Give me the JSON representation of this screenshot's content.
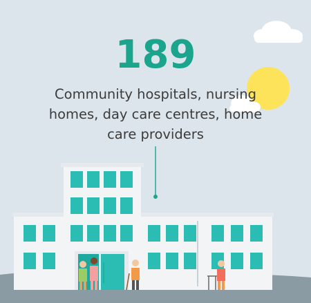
{
  "stat": {
    "number": "189",
    "caption": "Community hospitals, nursing homes, day care centres, home care providers"
  },
  "colors": {
    "background": "#dce5ec",
    "accent_number": "#1aa58c",
    "window_teal": "#2bbcb3",
    "building_white": "#f2f4f6",
    "sun": "#fde35a",
    "ground": "#8a9ba4"
  },
  "icons": [
    "cloud-icon",
    "sun-icon",
    "building-icon",
    "elderly-person-icon",
    "nurse-icon",
    "walker-icon",
    "cane-icon"
  ]
}
